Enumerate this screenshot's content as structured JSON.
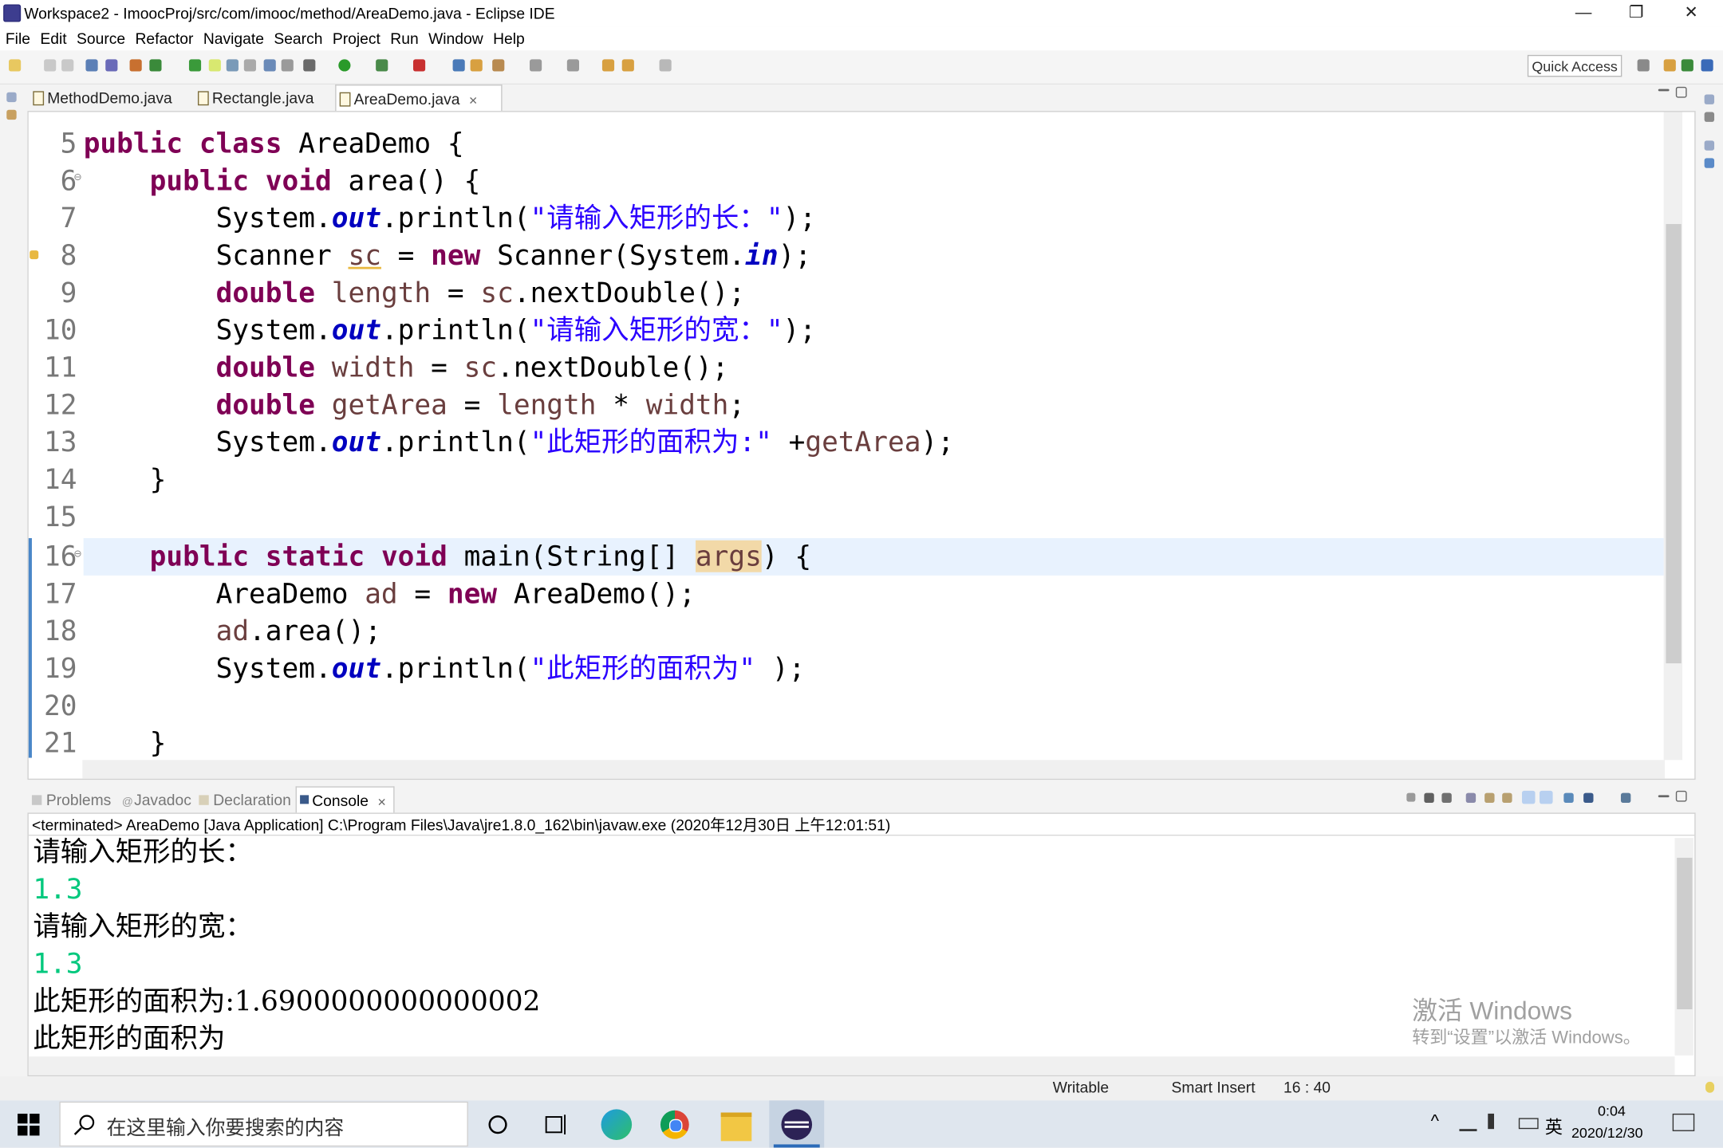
{
  "window": {
    "title": "Workspace2 - ImoocProj/src/com/imooc/method/AreaDemo.java - Eclipse IDE",
    "minimize": "—",
    "restore": "❐",
    "close": "✕"
  },
  "menu": [
    "File",
    "Edit",
    "Source",
    "Refactor",
    "Navigate",
    "Search",
    "Project",
    "Run",
    "Window",
    "Help"
  ],
  "toolbar": {
    "quick_access": "Quick Access"
  },
  "editor": {
    "tabs": [
      {
        "label": "MethodDemo.java"
      },
      {
        "label": "Rectangle.java"
      },
      {
        "label": "AreaDemo.java",
        "close": "✕"
      }
    ],
    "line_numbers": [
      "5",
      "6",
      "7",
      "8",
      "9",
      "10",
      "11",
      "12",
      "13",
      "14",
      "15",
      "16",
      "17",
      "18",
      "19",
      "20",
      "21"
    ],
    "fold_markers": {
      "l6": "⊖",
      "l16": "⊖"
    }
  },
  "console": {
    "tabs": [
      "Problems",
      "Javadoc",
      "Declaration",
      "Console"
    ],
    "close": "✕",
    "terminated": "<terminated> AreaDemo [Java Application] C:\\Program Files\\Java\\jre1.8.0_162\\bin\\javaw.exe (2020年12月30日 上午12:01:51)",
    "lines": [
      "请输入矩形的长：",
      "1.3",
      "请输入矩形的宽：",
      "1.3",
      "此矩形的面积为:1.6900000000000002",
      "此矩形的面积为"
    ],
    "watermark_title": "激活 Windows",
    "watermark_sub": "转到“设置”以激活 Windows。"
  },
  "status": {
    "writable": "Writable",
    "insert_mode": "Smart Insert",
    "position": "16 : 40"
  },
  "taskbar": {
    "search_placeholder": "在这里输入你要搜索的内容",
    "ime": "英",
    "time": "0:04",
    "date": "2020/12/30"
  },
  "colors": {
    "keyword": "#7f0055",
    "string": "#2a00ff",
    "static_field": "#0000c0",
    "local_var": "#6a3e3e",
    "console_input": "#00c87d",
    "current_line": "#e8f2fe"
  },
  "icons": [
    "eclipse-icon",
    "search-icon",
    "cortana-icon",
    "task-view-icon",
    "edge-icon",
    "chrome-icon",
    "explorer-icon",
    "eclipse-taskbar-icon",
    "windows-start-icon",
    "notification-icon"
  ]
}
